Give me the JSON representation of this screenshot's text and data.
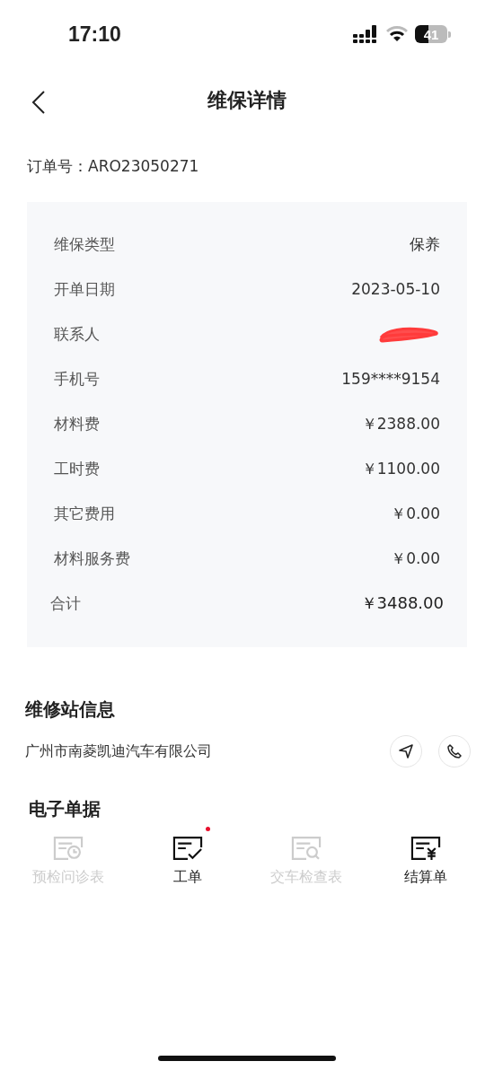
{
  "status_bar": {
    "time": "17:10",
    "battery": "41"
  },
  "header": {
    "title": "维保详情"
  },
  "order": {
    "label": "订单号：",
    "number": "ARO23050271"
  },
  "details": [
    {
      "label": "维保类型",
      "value": "保养",
      "kind": "text"
    },
    {
      "label": "开单日期",
      "value": "2023-05-10",
      "kind": "text"
    },
    {
      "label": "联系人",
      "kind": "redacted"
    },
    {
      "label": "手机号",
      "value": "159****9154",
      "kind": "text"
    },
    {
      "label": "材料费",
      "value": "￥2388.00",
      "kind": "text"
    },
    {
      "label": "工时费",
      "value": "￥1100.00",
      "kind": "text"
    },
    {
      "label": "其它费用",
      "value": "￥0.00",
      "kind": "text"
    },
    {
      "label": "材料服务费",
      "value": "￥0.00",
      "kind": "text"
    },
    {
      "label": "合计",
      "value": "￥3488.00",
      "kind": "total"
    }
  ],
  "station": {
    "title": "维修站信息",
    "name": "广州市南菱凯迪汽车有限公司"
  },
  "documents": {
    "title": "电子单据",
    "items": [
      {
        "label": "预检问诊表",
        "disabled": true,
        "unread": false
      },
      {
        "label": "工单",
        "disabled": false,
        "unread": true
      },
      {
        "label": "交车检查表",
        "disabled": true,
        "unread": false
      },
      {
        "label": "结算单",
        "disabled": false,
        "unread": false
      }
    ]
  }
}
